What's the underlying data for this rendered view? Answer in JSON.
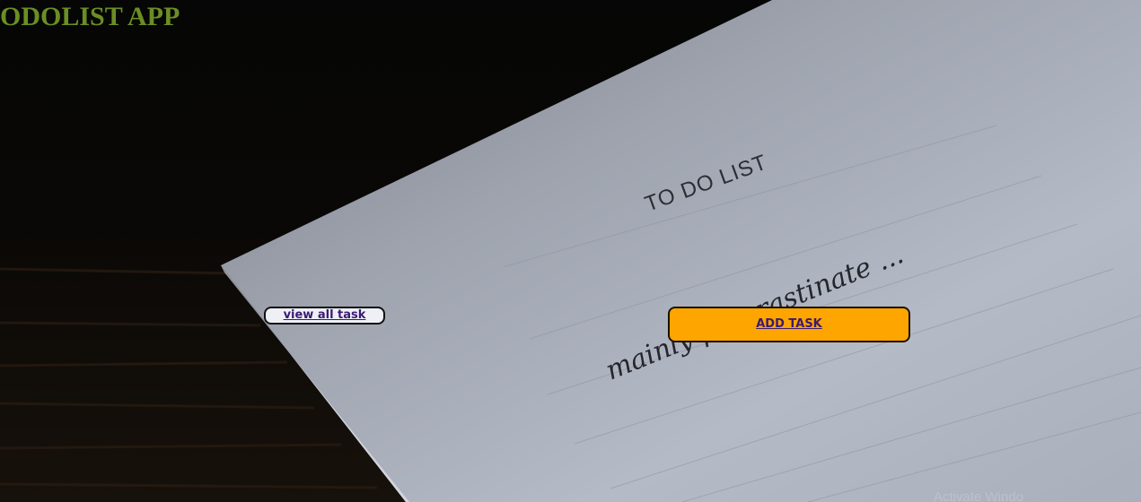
{
  "app": {
    "title": "ODOLIST APP"
  },
  "background_photo": {
    "paper_heading": "TO DO LIST",
    "paper_handwriting": "mainly procrastinate ..."
  },
  "buttons": {
    "view_all_label": "view all task",
    "add_task_label": "ADD TASK"
  },
  "system": {
    "watermark_text": "Activate Windo"
  },
  "colors": {
    "title": "#6b8e23",
    "add_button": "#ffa500",
    "view_button": "#eef0f6",
    "button_text": "#3b1a74",
    "background": "#050605",
    "paper": "#b4bac6"
  }
}
